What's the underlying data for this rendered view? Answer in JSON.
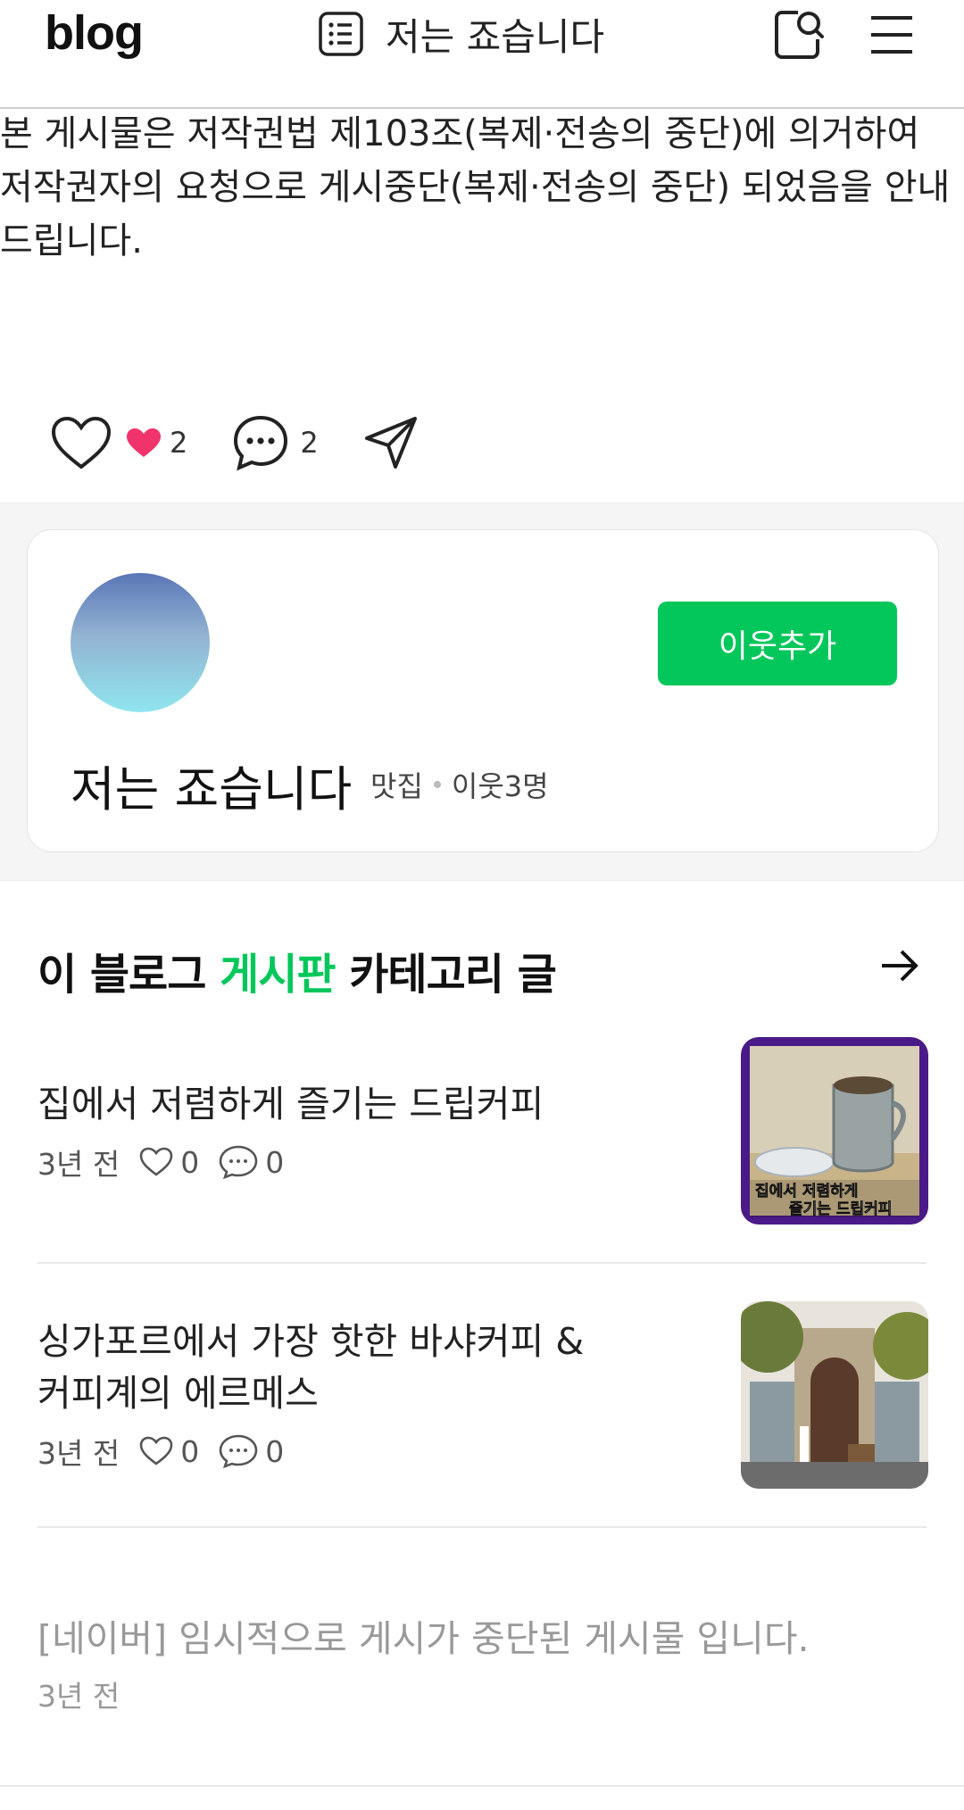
{
  "header": {
    "logo": "blog",
    "title": "저는 죠습니다"
  },
  "notice": {
    "text": "본 게시물은 저작권법 제103조(복제·전송의 중단)에 의거하여 저작권자의 요청으로 게시중단(복제·전송의 중단) 되었음을 안내 드립니다."
  },
  "reactions": {
    "like_count": "2",
    "comment_count": "2"
  },
  "profile": {
    "name": "저는 죠습니다",
    "category": "맛집",
    "neighbors": "이웃3명",
    "add_button": "이웃추가"
  },
  "category_section": {
    "title_prefix": "이 블로그 ",
    "title_highlight": "게시판",
    "title_suffix": " 카테고리 글"
  },
  "posts": [
    {
      "title": "집에서 저렴하게 즐기는 드립커피",
      "time": "3년 전",
      "likes": "0",
      "comments": "0",
      "thumb_caption_1": "집에서 저렴하게",
      "thumb_caption_2": "즐기는 드립커피"
    },
    {
      "title": "싱가포르에서 가장 핫한 바샤커피 & 커피계의 에르메스",
      "time": "3년 전",
      "likes": "0",
      "comments": "0"
    },
    {
      "title": "[네이버] 임시적으로 게시가 중단된 게시물 입니다.",
      "time": "3년 전"
    }
  ],
  "colors": {
    "accent": "#03c75a",
    "like_pink": "#f0346b"
  }
}
